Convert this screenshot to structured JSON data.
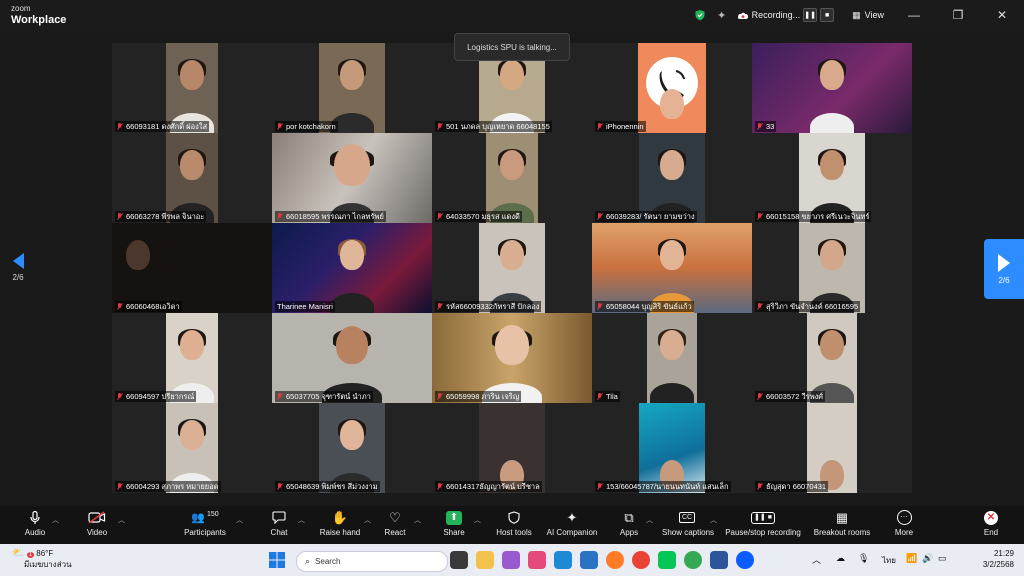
{
  "app": {
    "brand_small": "zoom",
    "brand_name": "Workplace"
  },
  "titlebar": {
    "recording_label": "Recording...",
    "view_label": "View"
  },
  "talking_banner": "Logistics SPU is talking...",
  "pagination": {
    "left": "2/6",
    "right": "2/6"
  },
  "participants": [
    {
      "name": "66093181 ดงศักดิ์ ผ่องใส",
      "muted": true
    },
    {
      "name": "por kotchakorn",
      "muted": true
    },
    {
      "name": "501 นภดล บุญเหยาด 66048155",
      "muted": true
    },
    {
      "name": "iPhonennin",
      "muted": true
    },
    {
      "name": "33",
      "muted": true
    },
    {
      "name": "66063278 พีรพล จินาอะ",
      "muted": true
    },
    {
      "name": "66018595 พรรณภา ไกลทรัพย์",
      "muted": true
    },
    {
      "name": "64033570 มธุรส แดงดี",
      "muted": true
    },
    {
      "name": "66039283/ รัตนา ยามขว่าง",
      "muted": true
    },
    {
      "name": "66015158 ขยาภร ศรีเนวะจินทร์",
      "muted": true
    },
    {
      "name": "66060468เอวิดา",
      "muted": true
    },
    {
      "name": "Tharinee Manisri",
      "muted": false
    },
    {
      "name": "รหัส66009332กัทราสี ปักลอง",
      "muted": true
    },
    {
      "name": "65058044 บุญสิริ ขันธ์แก้ว",
      "muted": true
    },
    {
      "name": "สุริวิภา ขันจำนงค์ 66016595",
      "muted": true
    },
    {
      "name": "66094597 ปรียากรณ์",
      "muted": true
    },
    {
      "name": "65037705 จุฑารัตน์ นำภา",
      "muted": true
    },
    {
      "name": "65059998 ภาริน เจริญ",
      "muted": true
    },
    {
      "name": "Tila",
      "muted": true
    },
    {
      "name": "66003572 วีรพงศ์",
      "muted": true
    },
    {
      "name": "66004293 สุภาพร หมายยอด",
      "muted": true
    },
    {
      "name": "65048639 พิมพ์ชร สีม่วงงาม",
      "muted": true
    },
    {
      "name": "66014317ธัญญารัตน์ บรีชาล",
      "muted": true
    },
    {
      "name": "153/66045787/นายนนทนันท์ แสนเล็ก",
      "muted": true
    },
    {
      "name": "ธัญสุดา 66070431",
      "muted": true
    }
  ],
  "toolbar": {
    "audio": "Audio",
    "video": "Video",
    "participants": "Participants",
    "participant_count": "150",
    "chat": "Chat",
    "raise_hand": "Raise hand",
    "react": "React",
    "share": "Share",
    "host_tools": "Host tools",
    "ai_companion": "AI Companion",
    "apps": "Apps",
    "show_captions": "Show captions",
    "pause_stop_recording": "Pause/stop recording",
    "breakout_rooms": "Breakout rooms",
    "more": "More",
    "end": "End"
  },
  "taskbar": {
    "temperature": "86°F",
    "weather_text": "มีเมฆบางส่วน",
    "notification_count": "1",
    "search_placeholder": "Search",
    "language": "ไทย",
    "time": "21:29",
    "date": "3/2/2568"
  },
  "colors": {
    "accent_blue": "#2d8cff",
    "mute_red": "#e0393e",
    "share_green": "#23b35b"
  }
}
